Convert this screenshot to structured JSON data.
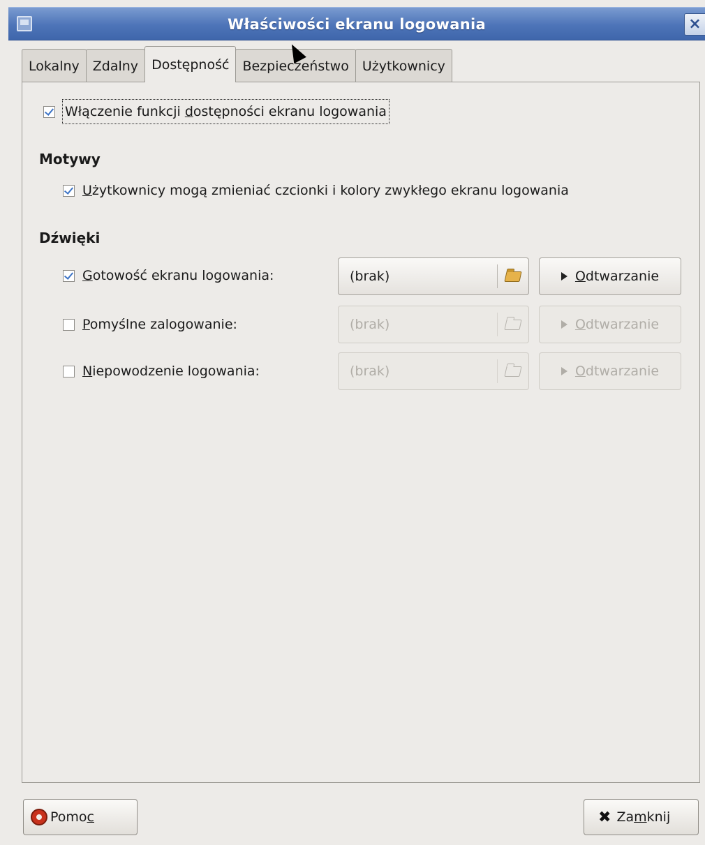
{
  "window": {
    "title": "Właściwości ekranu logowania",
    "close_glyph": "×"
  },
  "tabs": [
    {
      "label": "Lokalny",
      "active": false
    },
    {
      "label": "Zdalny",
      "active": false
    },
    {
      "label": "Dostępność",
      "active": true
    },
    {
      "label": "Bezpieczeństwo",
      "active": false
    },
    {
      "label": "Użytkownicy",
      "active": false
    }
  ],
  "accessibility": {
    "enable": {
      "pre": "Włączenie funkcji ",
      "mnemonic": "d",
      "post": "ostępności ekranu logowania",
      "checked": true
    }
  },
  "themes": {
    "heading": "Motywy",
    "users_change": {
      "pre": "",
      "mnemonic": "U",
      "post": "żytkownicy mogą zmieniać czcionki i kolory zwykłego ekranu logowania",
      "checked": true
    }
  },
  "sounds": {
    "heading": "Dźwięki",
    "rows": [
      {
        "pre": "",
        "mnemonic": "G",
        "post": "otowość ekranu logowania:",
        "checked": true,
        "file": "(brak)",
        "play_mnemonic": "O",
        "play_rest": "dtwarzanie",
        "enabled": true
      },
      {
        "pre": "",
        "mnemonic": "P",
        "post": "omyślne zalogowanie:",
        "checked": false,
        "file": "(brak)",
        "play_mnemonic": "O",
        "play_rest": "dtwarzanie",
        "enabled": false
      },
      {
        "pre": "",
        "mnemonic": "N",
        "post": "iepowodzenie logowania:",
        "checked": false,
        "file": "(brak)",
        "play_mnemonic": "O",
        "play_rest": "dtwarzanie",
        "enabled": false
      }
    ]
  },
  "footer": {
    "help": {
      "pre": "Pomo",
      "mnemonic": "c",
      "post": ""
    },
    "close": {
      "pre": "Za",
      "mnemonic": "m",
      "post": "knij"
    }
  },
  "icons": {
    "app": "window-icon",
    "folder": "folder-open-icon",
    "play": "play-icon",
    "help": "lifebuoy-icon",
    "close": "close-x-icon"
  }
}
